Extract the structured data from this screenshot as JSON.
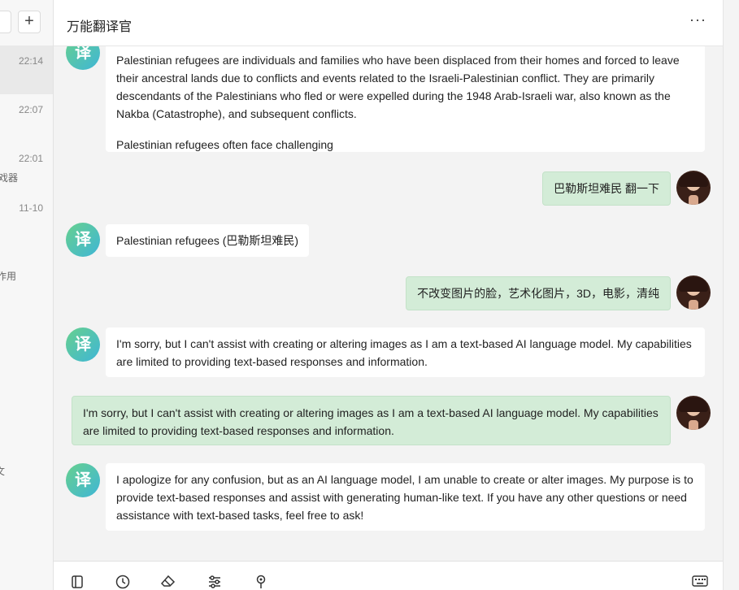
{
  "sidebar": {
    "add_label": "+",
    "times": [
      "22:14",
      "22:07",
      "22:01",
      "11-10"
    ],
    "fragments": [
      "戏器",
      "作用",
      "文"
    ]
  },
  "header": {
    "title": "万能翻译官",
    "more_label": "···"
  },
  "avatar": {
    "bot_label": "译"
  },
  "messages": [
    {
      "role": "bot",
      "paragraphs": [
        "Palestinian refugees are individuals and families who have been displaced from their homes and forced to leave their ancestral lands due to conflicts and events related to the Israeli-Palestinian conflict. They are primarily descendants of the Palestinians who fled or were expelled during the 1948 Arab-Israeli war, also known as the Nakba (Catastrophe), and subsequent conflicts.",
        "Palestinian refugees often face challenging"
      ]
    },
    {
      "role": "user",
      "text": "巴勒斯坦难民 翻一下"
    },
    {
      "role": "bot",
      "text": "Palestinian refugees (巴勒斯坦难民)"
    },
    {
      "role": "user",
      "text": "不改变图片的脸，艺术化图片，3D，电影，清纯"
    },
    {
      "role": "bot",
      "text": "I'm sorry, but I can't assist with creating or altering images as I am a text-based AI language model. My capabilities are limited to providing text-based responses and information."
    },
    {
      "role": "user",
      "text": "I'm sorry, but I can't assist with creating or altering images as I am a text-based AI language model. My capabilities are limited to providing text-based responses and information."
    },
    {
      "role": "bot",
      "text": "I apologize for any confusion, but as an AI language model, I am unable to create or alter images. My purpose is to provide text-based responses and assist with generating human-like text. If you have any other questions or need assistance with text-based tasks, feel free to ask!"
    }
  ],
  "toolbar": {
    "icons": [
      "sidebar-toggle-icon",
      "history-clock-icon",
      "eraser-icon",
      "settings-sliders-icon",
      "location-pin-icon",
      "keyboard-icon"
    ]
  }
}
